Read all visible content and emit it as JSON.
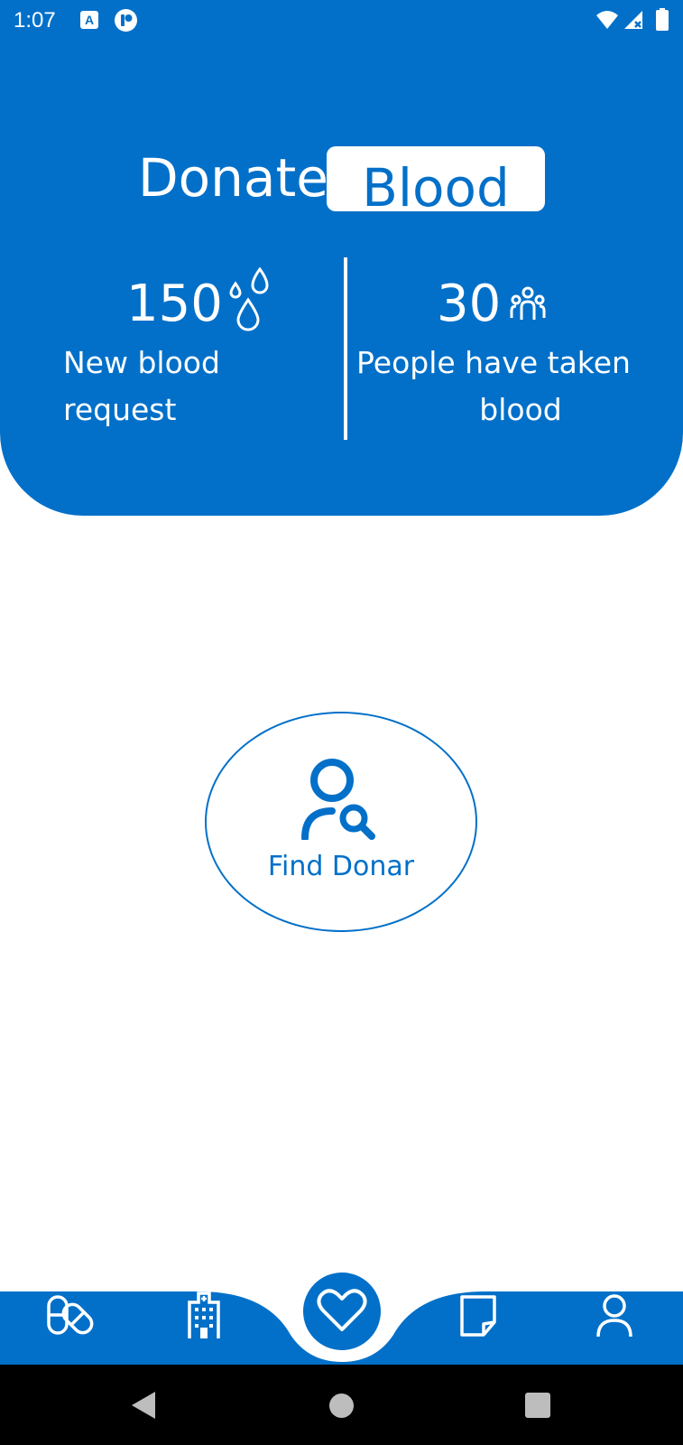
{
  "status_bar": {
    "time": "1:07",
    "a_icon_letter": "A"
  },
  "header": {
    "title_word_1": "Donate",
    "title_word_2": "Blood",
    "stats": {
      "new_requests": {
        "value": "150",
        "label": "New blood request",
        "icon": "blood-drops-icon"
      },
      "taken": {
        "value": "30",
        "label_line_1": "People have taken",
        "label_line_2": "blood",
        "icon": "people-group-icon"
      }
    }
  },
  "main": {
    "find_donor_label": "Find Donar",
    "find_donor_icon": "person-search-icon"
  },
  "bottom_nav": {
    "items": [
      {
        "icon": "pills-icon"
      },
      {
        "icon": "hospital-icon"
      },
      {
        "icon": "heart-icon",
        "active": true
      },
      {
        "icon": "note-icon"
      },
      {
        "icon": "profile-icon"
      }
    ]
  },
  "colors": {
    "primary": "#0270c9",
    "surface": "#ffffff",
    "system_nav": "#000000"
  }
}
